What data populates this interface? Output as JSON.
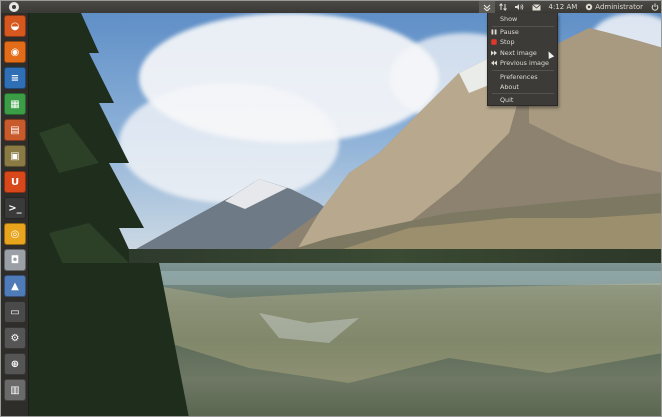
{
  "panel": {
    "clock": "4:12 AM",
    "user": "Administrator",
    "indicators": [
      "wallpaper-changer-icon",
      "network-icon",
      "volume-icon",
      "mail-icon",
      "session-icon"
    ]
  },
  "launcher": {
    "items": [
      {
        "icon": "ubuntu-software-center-icon",
        "color": "#d6581f"
      },
      {
        "icon": "firefox-icon",
        "color": "#e36c1b"
      },
      {
        "icon": "libreoffice-writer-icon",
        "color": "#2f6fb5"
      },
      {
        "icon": "libreoffice-calc-icon",
        "color": "#3b9d45"
      },
      {
        "icon": "libreoffice-impress-icon",
        "color": "#c85a2b"
      },
      {
        "icon": "file-archive-icon",
        "color": "#8a7a43"
      },
      {
        "icon": "ubuntu-one-icon",
        "color": "#d9481b"
      },
      {
        "icon": "terminal-icon",
        "color": "#3a3a3a"
      },
      {
        "icon": "chromium-icon",
        "color": "#e8a41d"
      },
      {
        "icon": "camera-icon",
        "color": "#9aa0a6"
      },
      {
        "icon": "image-viewer-icon",
        "color": "#4f7cb8"
      },
      {
        "icon": "workspace-switcher-icon",
        "color": "#4a4a4a"
      },
      {
        "icon": "settings-icon",
        "color": "#555555"
      },
      {
        "icon": "lock-icon",
        "color": "#555555"
      },
      {
        "icon": "trash-icon",
        "color": "#6a6a6a"
      }
    ]
  },
  "menu": {
    "show": "Show",
    "pause": "Pause",
    "stop": "Stop",
    "next": "Next image",
    "previous": "Previous image",
    "preferences": "Preferences",
    "about": "About",
    "quit": "Quit",
    "stop_color": "#e0392b"
  }
}
